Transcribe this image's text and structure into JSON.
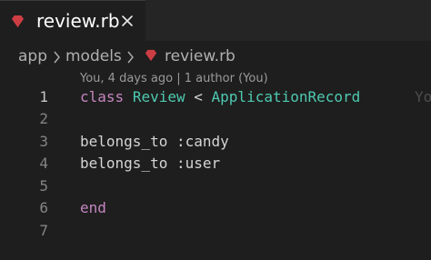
{
  "tab": {
    "label": "review.rb",
    "file_icon": "ruby-icon",
    "close_icon": "close-icon"
  },
  "breadcrumb": {
    "items": [
      "app",
      "models",
      "review.rb"
    ],
    "separator_icon": "chevron-right-icon"
  },
  "blame": {
    "text": "You, 4 days ago | 1 author (You)",
    "inline": "Yo"
  },
  "editor": {
    "line_numbers": [
      "1",
      "2",
      "3",
      "4",
      "5",
      "6",
      "7"
    ],
    "active_line": "1",
    "lines": {
      "l1": {
        "kw": "class",
        "name": "Review",
        "op": "<",
        "base": "ApplicationRecord"
      },
      "l3": "belongs_to :candy",
      "l4": "belongs_to :user",
      "l6": "end"
    }
  },
  "colors": {
    "background": "#1e1e1e",
    "keyword": "#c586c0",
    "constant": "#4ec9b0",
    "ruby_icon": "#cc3e44"
  }
}
